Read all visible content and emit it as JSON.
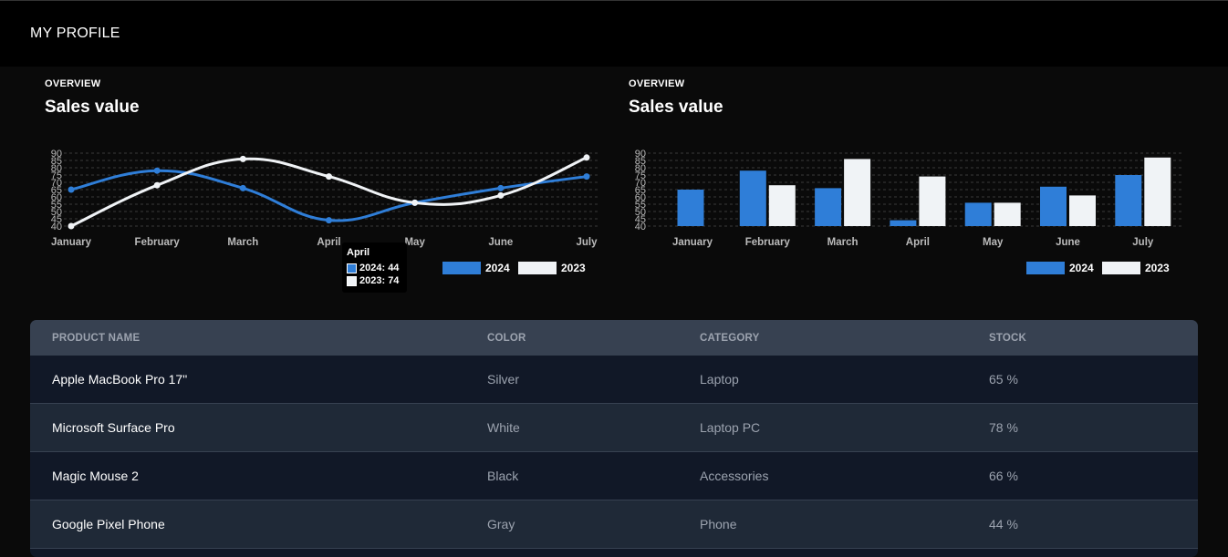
{
  "topbar": {
    "title": "MY PROFILE"
  },
  "charts": {
    "left": {
      "eyebrow": "OVERVIEW",
      "heading": "Sales value"
    },
    "right": {
      "eyebrow": "OVERVIEW",
      "heading": "Sales value"
    }
  },
  "tooltip": {
    "title": "April",
    "line1": "2024: 44",
    "line2": "2023: 74"
  },
  "colors": {
    "series2024": "#2f7ed8",
    "series2023": "#f0f3f6",
    "grid": "#3a3a3a"
  },
  "chart_data": [
    {
      "type": "line",
      "categories": [
        "January",
        "February",
        "March",
        "April",
        "May",
        "June",
        "July"
      ],
      "series": [
        {
          "name": "2024",
          "values": [
            65,
            78,
            66,
            44,
            56,
            66,
            74
          ]
        },
        {
          "name": "2023",
          "values": [
            40,
            68,
            86,
            74,
            56,
            61,
            87
          ]
        }
      ],
      "yticks": [
        40,
        45,
        50,
        55,
        60,
        65,
        70,
        75,
        80,
        85,
        90
      ],
      "ylim": [
        40,
        90
      ],
      "legend": "bottom-right",
      "grid": true
    },
    {
      "type": "bar",
      "categories": [
        "January",
        "February",
        "March",
        "April",
        "May",
        "June",
        "July"
      ],
      "series": [
        {
          "name": "2024",
          "values": [
            65,
            78,
            66,
            44,
            56,
            67,
            75
          ]
        },
        {
          "name": "2023",
          "values": [
            null,
            68,
            86,
            74,
            56,
            61,
            87
          ]
        }
      ],
      "yticks": [
        40,
        45,
        50,
        55,
        60,
        65,
        70,
        75,
        80,
        85,
        90
      ],
      "ylim": [
        40,
        90
      ],
      "legend": "bottom-right",
      "grid": true
    }
  ],
  "table": {
    "headers": [
      "PRODUCT NAME",
      "COLOR",
      "CATEGORY",
      "STOCK"
    ],
    "rows": [
      {
        "name": "Apple MacBook Pro 17\"",
        "color": "Silver",
        "category": "Laptop",
        "stock": "65 %"
      },
      {
        "name": "Microsoft Surface Pro",
        "color": "White",
        "category": "Laptop PC",
        "stock": "78 %"
      },
      {
        "name": "Magic Mouse 2",
        "color": "Black",
        "category": "Accessories",
        "stock": "66 %"
      },
      {
        "name": "Google Pixel Phone",
        "color": "Gray",
        "category": "Phone",
        "stock": "44 %"
      }
    ]
  }
}
